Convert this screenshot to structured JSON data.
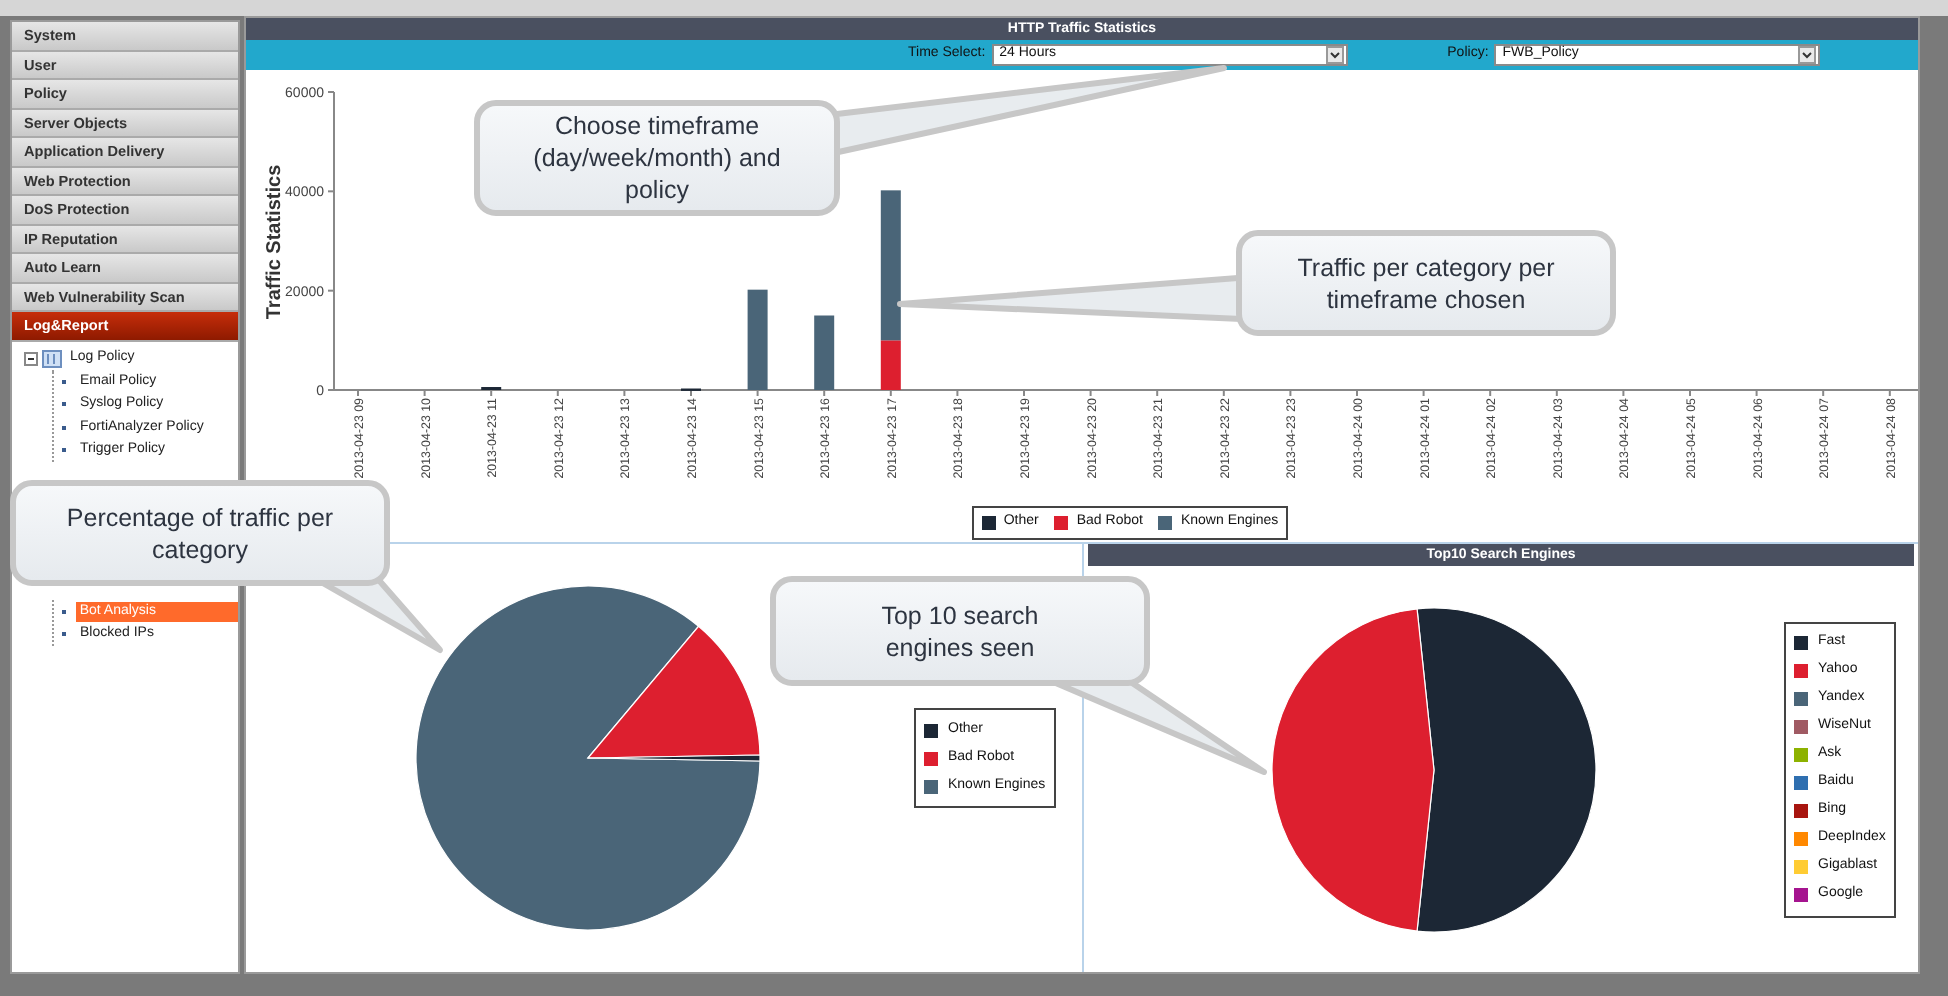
{
  "sidebar": {
    "menu": [
      {
        "label": "System",
        "selected": false
      },
      {
        "label": "User",
        "selected": false
      },
      {
        "label": "Policy",
        "selected": false
      },
      {
        "label": "Server Objects",
        "selected": false
      },
      {
        "label": "Application Delivery",
        "selected": false
      },
      {
        "label": "Web Protection",
        "selected": false
      },
      {
        "label": "DoS Protection",
        "selected": false
      },
      {
        "label": "IP Reputation",
        "selected": false
      },
      {
        "label": "Auto Learn",
        "selected": false
      },
      {
        "label": "Web Vulnerability Scan",
        "selected": false
      },
      {
        "label": "Log&Report",
        "selected": true
      }
    ],
    "tree": [
      {
        "label": "Log Policy",
        "expanded": true,
        "children": [
          {
            "label": "Email Policy",
            "selected": false
          },
          {
            "label": "Syslog Policy",
            "selected": false
          },
          {
            "label": "FortiAnalyzer Policy",
            "selected": false
          },
          {
            "label": "Trigger Policy",
            "selected": false
          }
        ]
      }
    ],
    "tree_lower": [
      {
        "label": "Bot Analysis",
        "selected": true
      },
      {
        "label": "Blocked IPs",
        "selected": false
      }
    ]
  },
  "traffic_panel": {
    "title": "HTTP Traffic Statistics",
    "time_select": {
      "label": "Time Select:",
      "value": "24 Hours"
    },
    "policy": {
      "label": "Policy:",
      "value": "FWB_Policy"
    },
    "chart_data": {
      "type": "bar",
      "legend": true,
      "ylabel": "Traffic Statistics",
      "stacked": true,
      "ylim": [
        0,
        60000
      ],
      "yticks": [
        0,
        20000,
        40000,
        60000
      ],
      "categories": [
        "2013-04-23 09",
        "2013-04-23 10",
        "2013-04-23 11",
        "2013-04-23 12",
        "2013-04-23 13",
        "2013-04-23 14",
        "2013-04-23 15",
        "2013-04-23 16",
        "2013-04-23 17",
        "2013-04-23 18",
        "2013-04-23 19",
        "2013-04-23 20",
        "2013-04-23 21",
        "2013-04-23 22",
        "2013-04-23 23",
        "2013-04-24 00",
        "2013-04-24 01",
        "2013-04-24 02",
        "2013-04-24 03",
        "2013-04-24 04",
        "2013-04-24 05",
        "2013-04-24 06",
        "2013-04-24 07",
        "2013-04-24 08"
      ],
      "series": [
        {
          "name": "Other",
          "color": "#1c2735",
          "values": [
            0,
            0,
            600,
            0,
            0,
            300,
            0,
            0,
            0,
            0,
            0,
            0,
            0,
            0,
            0,
            0,
            0,
            0,
            0,
            0,
            0,
            0,
            0,
            0
          ]
        },
        {
          "name": "Bad Robot",
          "color": "#dd1f2f",
          "values": [
            0,
            0,
            0,
            0,
            0,
            0,
            0,
            0,
            10000,
            0,
            0,
            0,
            0,
            0,
            0,
            0,
            0,
            0,
            0,
            0,
            0,
            0,
            0,
            0
          ]
        },
        {
          "name": "Known Engines",
          "color": "#4a6578",
          "values": [
            0,
            0,
            0,
            0,
            0,
            0,
            20200,
            15000,
            30200,
            0,
            0,
            0,
            0,
            0,
            0,
            0,
            0,
            0,
            0,
            0,
            0,
            0,
            0,
            0
          ]
        }
      ]
    }
  },
  "category_pie": {
    "legend": [
      {
        "label": "Other",
        "color": "#1c2735"
      },
      {
        "label": "Bad Robot",
        "color": "#dd1f2f"
      },
      {
        "label": "Known Engines",
        "color": "#4a6578"
      }
    ]
  },
  "engines_panel": {
    "title": "Top10 Search Engines",
    "legend": [
      {
        "label": "Fast",
        "color": "#1c2735"
      },
      {
        "label": "Yahoo",
        "color": "#dd1f2f"
      },
      {
        "label": "Yandex",
        "color": "#4a6578"
      },
      {
        "label": "WiseNut",
        "color": "#a05a63"
      },
      {
        "label": "Ask",
        "color": "#8db200"
      },
      {
        "label": "Baidu",
        "color": "#2f6fb0"
      },
      {
        "label": "Bing",
        "color": "#a8150f"
      },
      {
        "label": "DeepIndex",
        "color": "#ff8800"
      },
      {
        "label": "Gigablast",
        "color": "#ffcc33"
      },
      {
        "label": "Google",
        "color": "#a5148f"
      }
    ]
  },
  "callouts": [
    {
      "text": "Choose timeframe (day/week/month) and policy"
    },
    {
      "text": "Traffic  per category per timeframe chosen"
    },
    {
      "text": "Percentage of traffic per category"
    },
    {
      "text": "Top 10 search engines seen"
    }
  ]
}
